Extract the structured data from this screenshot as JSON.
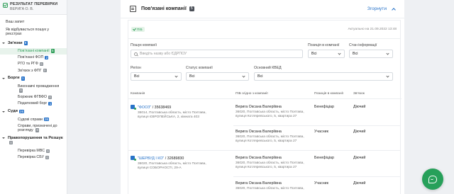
{
  "sidebar": {
    "header": {
      "title": "РЕЗУЛЬТАТ ПЕРЕВІРКИ",
      "subtitle": "ВЕРИГА О. В."
    },
    "top_items": [
      {
        "label": "Ваш запит"
      },
      {
        "label": "Як відбувається пошук у реєстрах"
      }
    ],
    "sections": [
      {
        "label": "Зв'язки",
        "count": "6",
        "items": [
          {
            "label": "Пов'язані компанії",
            "count": "5"
          },
          {
            "label": "Пов'язані ФОП",
            "count": "2"
          },
          {
            "label": "РГО та РГФ",
            "count": "0"
          },
          {
            "label": "Зв'язок з ФПГ",
            "count": "0"
          }
        ]
      },
      {
        "label": "Борги",
        "count": "1",
        "items": [
          {
            "label": "Виконавчі провадження",
            "count": "0"
          },
          {
            "label": "Боржник ФГВФО",
            "count": "0"
          },
          {
            "label": "Податковий борг",
            "count": "1"
          }
        ]
      },
      {
        "label": "Суди",
        "count": "26",
        "items": [
          {
            "label": "Судові справи",
            "count": "26"
          },
          {
            "label": "Справи, призначені до розгляду",
            "count": "0"
          }
        ]
      },
      {
        "label": "Правопорушення та Розшук",
        "count": "0",
        "items": [
          {
            "label": "Перевірка МВС",
            "count": "0"
          },
          {
            "label": "Перевірка СБУ",
            "count": "0"
          }
        ]
      }
    ]
  },
  "main": {
    "title": "Пов'язані компанії",
    "count": "5",
    "collapse_label": "Згорнути",
    "status_pill": "ПІБ",
    "actual_text": "Актуально на 21.09.2022 13:48",
    "filters": {
      "search_label": "Пошук компанії",
      "search_placeholder": "Введіть назву або ЄДРПОУ",
      "position_label": "Позиція в компанії",
      "position_value": "Всі",
      "info_state_label": "Стан інформації",
      "info_state_value": "Всі",
      "region_label": "Регіон",
      "region_value": "Всі",
      "company_status_label": "Статус компанії",
      "company_status_value": "Всі",
      "kved_label": "Основний КВЕД",
      "kved_value": "Всі"
    },
    "table": {
      "headers": [
        "Компанія",
        "ПІБ згідно з компанії",
        "Позиція в компанії",
        "Зв'язок"
      ],
      "rows": [
        {
          "company_name": "\"ФООЗ\"",
          "company_code": " / 35638469",
          "company_addr1": "36014, Полтавська область, місто Полтава,",
          "company_addr2": "вулиця ЄВРОПЕЙСЬКА, 2, кімната 403",
          "links": [
            {
              "name": "Верига Оксана Валеріївна",
              "addr1": "36020, Полтавська область, місто Полтава,",
              "addr2": "вулиця Котляревського, 5, квартира 27",
              "position": "Бенефіціар",
              "relation": "Діючий"
            },
            {
              "name": "Верига Оксана Валеріївна",
              "addr1": "36020, Полтавська область, місто Полтава,",
              "addr2": "вулиця Котляревського, 5, квартира 27",
              "position": "Учасник",
              "relation": "Діючий"
            }
          ]
        },
        {
          "company_name": "\"ШЕРВУД І КО\"",
          "company_code": " / 32689830",
          "company_addr1": "36020, Полтавська область, місто Полтава,",
          "company_addr2": "вулиця СОБОРНОСТІ, 29-А",
          "links": [
            {
              "name": "Верига Оксана Валеріївна",
              "addr1": "36020, Полтавська область, місто Полтава,",
              "addr2": "вулиця Котляревського, 5, квартира 27",
              "position": "Бенефіціар",
              "relation": "Діючий"
            },
            {
              "name": "Верига Оксана Валеріївна",
              "addr1": "36020, Полтавська область, місто Полтава,",
              "addr2": "",
              "position": "Учасник",
              "relation": "Діючий"
            }
          ]
        }
      ]
    }
  },
  "colors": {
    "accent_green": "#2e9e58",
    "link_blue": "#2873c9"
  },
  "icons": {
    "header": "building-icon",
    "company": "company-icon",
    "fab": "chat-icon"
  }
}
